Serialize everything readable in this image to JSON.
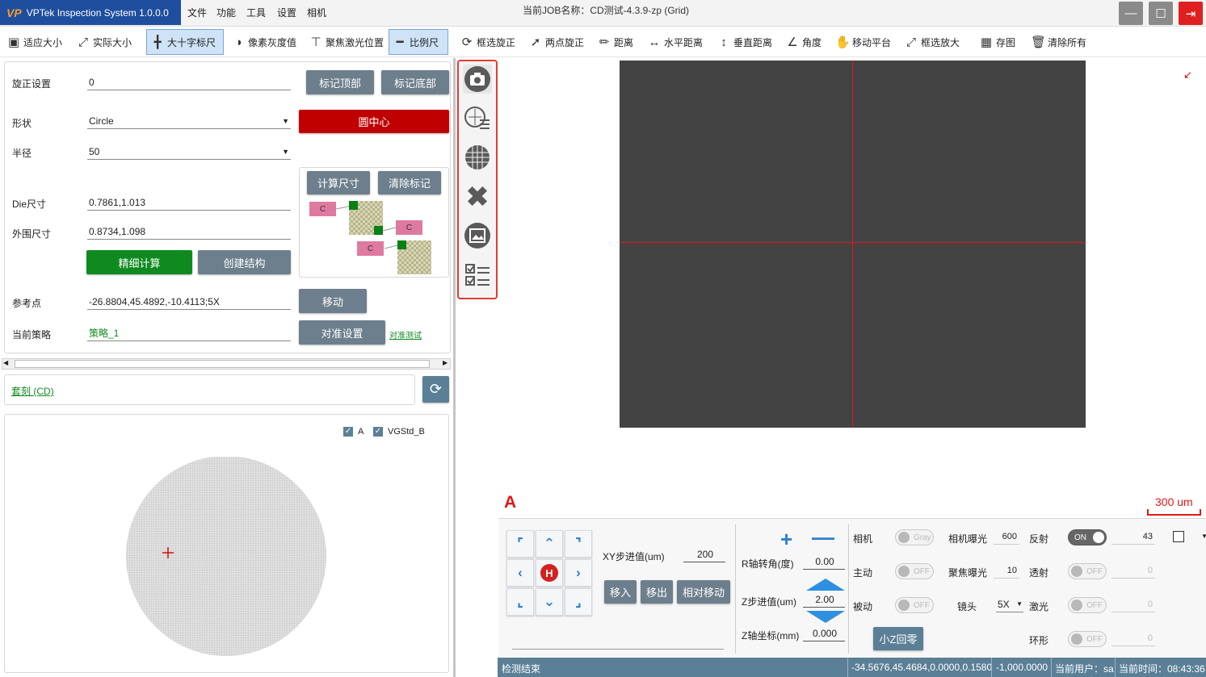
{
  "app": {
    "name": "VPTek Inspection System 1.0.0.0",
    "logo_text": "VP",
    "job_title": "当前JOB名称：CD测试-4.3.9-zp (Grid)"
  },
  "menu": [
    "文件",
    "功能",
    "工具",
    "设置",
    "相机"
  ],
  "toolbar": {
    "fit": "适应大小",
    "actual": "实际大小",
    "crosshair": "大十字标尺",
    "pixel_gray": "像素灰度值",
    "focus_laser": "聚焦激光位置",
    "scale": "比例尺",
    "box_rotate": "框选旋正",
    "two_point_rotate": "两点旋正",
    "distance": "距离",
    "h_distance": "水平距离",
    "v_distance": "垂直距离",
    "angle": "角度",
    "move_stage": "移动平台",
    "box_zoom": "框选放大",
    "save_image": "存图",
    "clear_all": "清除所有"
  },
  "form": {
    "rotate_label": "旋正设置",
    "rotate_value": "0",
    "mark_top": "标记顶部",
    "mark_bottom": "标记底部",
    "shape_label": "形状",
    "shape_value": "Circle",
    "circle_center": "圆中心",
    "radius_label": "半径",
    "radius_value": "50",
    "calc_size": "计算尺寸",
    "clear_marks": "清除标记",
    "c_label": "C",
    "die_label": "Die尺寸",
    "die_value": "0.7861,1.013",
    "outer_label": "外围尺寸",
    "outer_value": "0.8734,1.098",
    "fine_calc": "精细计算",
    "create_struct": "创建结构",
    "ref_label": "参考点",
    "ref_value": "-26.8804,45.4892,-10.4113;5X",
    "move": "移动",
    "strategy_label": "当前策略",
    "strategy_value": "策略_1",
    "align_settings": "对准设置",
    "align_test": "对准测试"
  },
  "recipe": {
    "link": "套刻 (CD)"
  },
  "wafer": {
    "legend_a": "A",
    "legend_b": "VGStd_B"
  },
  "viewer": {
    "label": "A",
    "scale_bar": "300 um"
  },
  "stage": {
    "xy_step_label": "XY步进值(um)",
    "xy_step_value": "200",
    "home": "H",
    "move_in": "移入",
    "move_out": "移出",
    "relative_move": "相对移动",
    "r_label": "R轴转角(度)",
    "r_value": "0.00",
    "z_step_label": "Z步进值(um)",
    "z_step_value": "2.00",
    "z_coord_label": "Z轴坐标(mm)",
    "z_coord_value": "0.000",
    "small_z_home": "小Z回零"
  },
  "camera": {
    "camera": "相机",
    "gray": "Gray",
    "active": "主动",
    "passive": "被动",
    "off": "OFF",
    "on": "ON",
    "exposure_label": "相机曝光",
    "exposure_value": "600",
    "focus_exposure_label": "聚焦曝光",
    "focus_exposure_value": "10",
    "lens_label": "镜头",
    "lens_value": "5X",
    "reflect": "反射",
    "reflect_value": "43",
    "transmit": "透射",
    "laser": "激光",
    "ring": "环形",
    "zero": "0"
  },
  "status": {
    "left": "检测结束",
    "coords": "-34.5676,45.4684,0.0000,0.1580",
    "pos2": "-1,000.0000",
    "user": "当前用户：sa",
    "time": "当前时间：08:43:36"
  },
  "colors": {
    "title_bg": "#1f4e9e",
    "red": "#c00000",
    "green": "#0f8a1f",
    "gray_btn": "#6d7f8c",
    "status_bg": "#5b7f96"
  }
}
